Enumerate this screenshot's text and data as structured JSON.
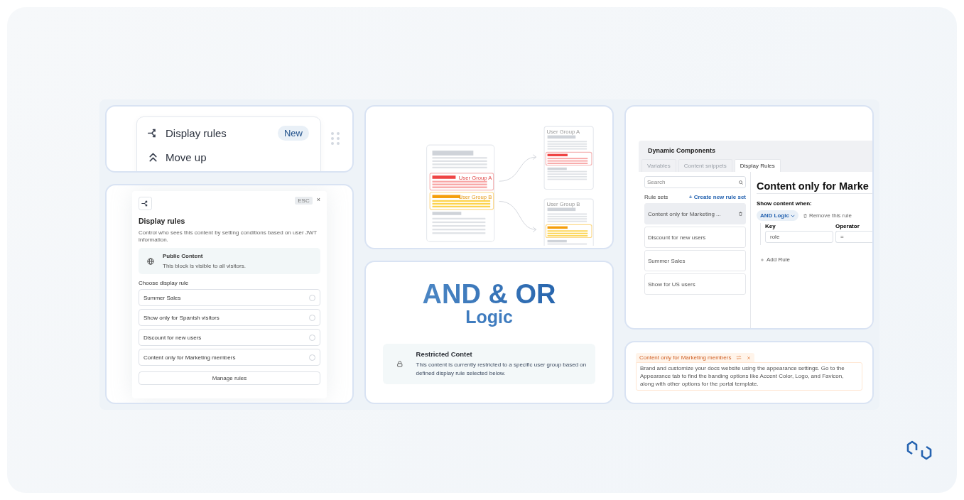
{
  "menu_card": {
    "items": [
      {
        "kind": "rules",
        "label": "Display rules",
        "badge": "New"
      },
      {
        "kind": "move",
        "label": "Move up"
      }
    ]
  },
  "rules_modal": {
    "esc": "ESC",
    "close": "×",
    "title": "Display rules",
    "description": "Control who sees this content by setting conditions based on user JWT information.",
    "public": {
      "title": "Public Content",
      "text": "This block is visible to all visitors."
    },
    "choose_label": "Choose display rule",
    "options": [
      {
        "label": "Summer Sales",
        "selected": false
      },
      {
        "label": "Show only for Spanish visitors",
        "selected": false
      },
      {
        "label": "Discount for new users",
        "selected": false
      },
      {
        "label": "Content only for Marketing members",
        "selected": false
      }
    ],
    "manage_button": "Manage rules"
  },
  "diagram": {
    "source_labels": [
      "User Group A",
      "User Group B"
    ],
    "target_labels": [
      "User Group A",
      "User Group B"
    ]
  },
  "logic_card": {
    "headline": "AND & OR",
    "subheadline": "Logic",
    "notice": {
      "title": "Restricted Contet",
      "text": "This content is currently restricted to a specific user group based on defined display rule selected below."
    }
  },
  "app_window": {
    "title": "Dynamic Components",
    "tabs": [
      {
        "label": "Variables",
        "selected": false
      },
      {
        "label": "Content snippets",
        "selected": false
      },
      {
        "label": "Display Rules",
        "selected": true
      }
    ],
    "search": {
      "placeholder": "Search"
    },
    "rule_sets_label": "Rule sets",
    "create_link": "+ Create new rule set",
    "rule_sets": [
      {
        "label": "Content only for Marketing ...",
        "selected": true
      },
      {
        "label": "Discount for new users",
        "selected": false
      },
      {
        "label": "Summer Sales",
        "selected": false
      },
      {
        "label": "Show for US users",
        "selected": false
      }
    ],
    "heading": "Content only for Marke",
    "show_when": "Show content when:",
    "logic_dropdown": "AND Logic",
    "remove_rule": "Remove this rule",
    "key_label": "Key",
    "operator_label": "Operator",
    "key_value": "role",
    "operator_value": "=",
    "add_rule": "Add Rule"
  },
  "tag_card": {
    "tag": "Content only for Marketing members",
    "text": "Brand and customize your docs website using the appearance settings. Go to the Appearance tab to find the banding options like Accent Color, Logo, and Favicon, along with other options for the portal template."
  }
}
